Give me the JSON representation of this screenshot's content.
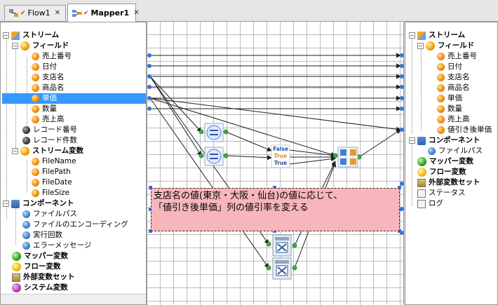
{
  "tabs": [
    {
      "label": "Flow1",
      "close": "✕",
      "active": false
    },
    {
      "label": "Mapper1",
      "close": "✕",
      "active": true
    }
  ],
  "left_tree": {
    "stream": "ストリーム",
    "field": "フィールド",
    "fields": [
      "売上番号",
      "日付",
      "支店名",
      "商品名",
      "単価",
      "数量",
      "売上高"
    ],
    "selected_field": "単価",
    "record_no": "レコード番号",
    "record_count": "レコード件数",
    "stream_var": "ストリーム変数",
    "stream_vars": [
      "FileName",
      "FilePath",
      "FileDate",
      "FileSize"
    ],
    "component": "コンポーネント",
    "component_items": [
      "ファイルパス",
      "ファイルのエンコーディング",
      "実行回数",
      "エラーメッセージ"
    ],
    "mapper_var": "マッパー変数",
    "flow_var": "フロー変数",
    "external_var": "外部変数セット",
    "system_var": "システム変数"
  },
  "right_tree": {
    "stream": "ストリーム",
    "field": "フィールド",
    "fields": [
      "売上番号",
      "日付",
      "支店名",
      "商品名",
      "単価",
      "数量",
      "売上高",
      "値引き後単価"
    ],
    "component": "コンポーネント",
    "component_items": [
      "ファイルパス"
    ],
    "mapper_var": "マッパー変数",
    "flow_var": "フロー変数",
    "external_var": "外部変数セット",
    "status": "ステータス",
    "log": "ログ"
  },
  "canvas": {
    "note_line1": "支店名の値(東京・大阪・仙台)の値に応じて、",
    "note_line2": "「値引き後単価」列の値引率を変える",
    "switch_false": "False",
    "switch_true1": "True",
    "switch_true2": "True"
  },
  "colors": {
    "selection": "#3399ff",
    "note_bg": "#f7b6bb",
    "canvas_bg": "#ffffff"
  }
}
